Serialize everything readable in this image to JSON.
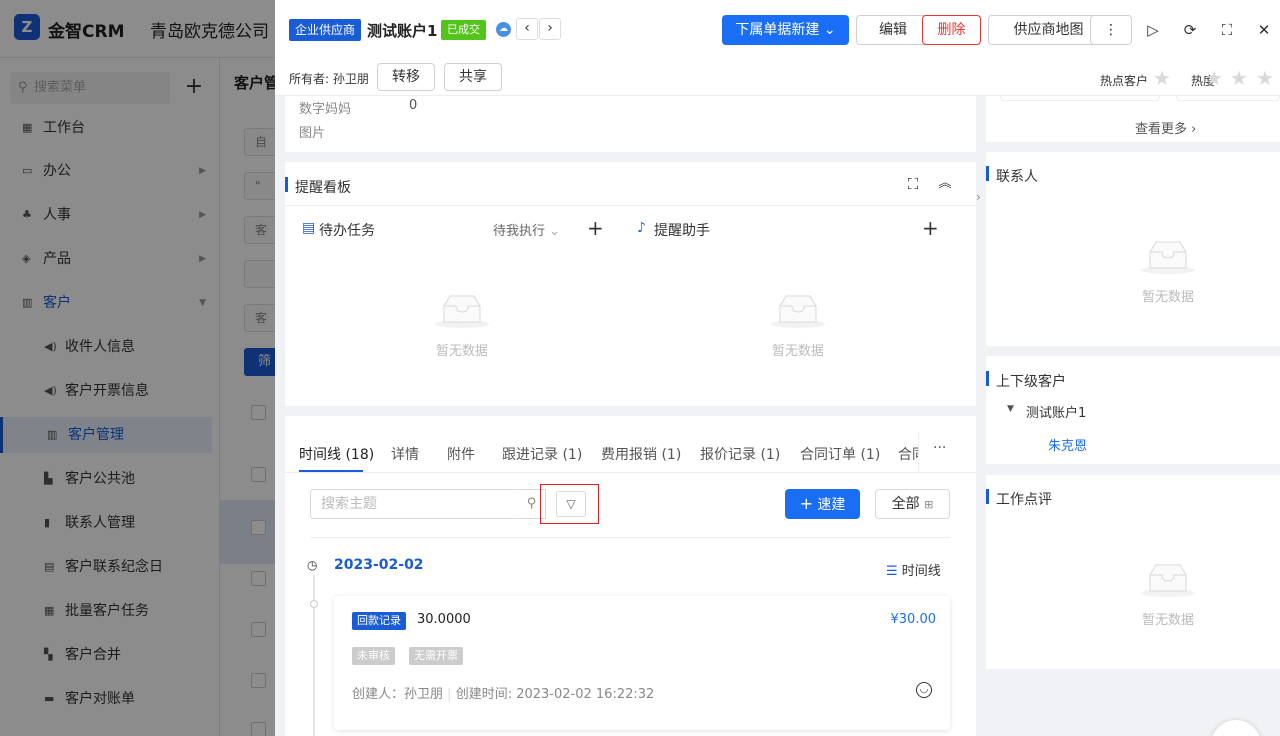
{
  "app": {
    "brand": "金智CRM",
    "company": "青岛欧克德公司",
    "logo_glyph": "Z",
    "accent": "#1a6ef5"
  },
  "sidebar": {
    "search_placeholder": "搜索菜单",
    "items": [
      {
        "label": "工作台",
        "icon": "dashboard-icon",
        "glyph": "▦"
      },
      {
        "label": "办公",
        "icon": "office-icon",
        "glyph": "▭",
        "has_arrow": true
      },
      {
        "label": "人事",
        "icon": "people-icon",
        "glyph": "♣",
        "has_arrow": true
      },
      {
        "label": "产品",
        "icon": "box-icon",
        "glyph": "◈",
        "has_arrow": true
      },
      {
        "label": "客户",
        "icon": "chart-icon",
        "glyph": "▥",
        "expanded": true
      }
    ],
    "sub_items": [
      {
        "label": "收件人信息",
        "icon": "speaker-icon",
        "glyph": "◀)"
      },
      {
        "label": "客户开票信息",
        "icon": "speaker-icon",
        "glyph": "◀)"
      },
      {
        "label": "客户管理",
        "icon": "chart-icon",
        "glyph": "▥",
        "active": true
      },
      {
        "label": "客户公共池",
        "icon": "pool-icon",
        "glyph": "▙"
      },
      {
        "label": "联系人管理",
        "icon": "contact-icon",
        "glyph": "▮"
      },
      {
        "label": "客户联系纪念日",
        "icon": "calendar-icon",
        "glyph": "▤"
      },
      {
        "label": "批量客户任务",
        "icon": "task-icon",
        "glyph": "▦"
      },
      {
        "label": "客户合并",
        "icon": "merge-icon",
        "glyph": "▚"
      },
      {
        "label": "客户对账单",
        "icon": "ledger-icon",
        "glyph": "▬"
      }
    ]
  },
  "background_page": {
    "title": "客户管",
    "stub1": "自",
    "stub2": "\"",
    "stub3": "客",
    "stub5": "客",
    "filter_btn": "筛"
  },
  "drawer": {
    "type_tag": "企业供应商",
    "title": "测试账户1",
    "status_tag": "已成交",
    "status_color": "#52c41a",
    "buttons": {
      "new_doc": "下属单据新建",
      "edit": "编辑",
      "delete": "删除",
      "supplier_map": "供应商地图"
    },
    "owner_label": "所有者:",
    "owner_name": "孙卫朋",
    "transfer": "转移",
    "share": "共享",
    "hot_customer": "热点客户",
    "heat": "热度",
    "heat_stars": 0
  },
  "info": {
    "digit_label": "数字妈妈",
    "digit_value": "0",
    "image_label": "图片"
  },
  "reminder": {
    "title": "提醒看板",
    "todo_title": "待办任务",
    "todo_filter": "待我执行",
    "assistant_title": "提醒助手",
    "empty": "暂无数据"
  },
  "tabs": [
    {
      "label": "时间线 (18)",
      "active": true
    },
    {
      "label": "详情"
    },
    {
      "label": "附件"
    },
    {
      "label": "跟进记录 (1)"
    },
    {
      "label": "费用报销 (1)"
    },
    {
      "label": "报价记录 (1)"
    },
    {
      "label": "合同订单 (1)"
    },
    {
      "label": "合同"
    }
  ],
  "timeline": {
    "search_placeholder": "搜索主题",
    "quick_new": "速建",
    "all": "全部",
    "view_label": "时间线",
    "date": "2023-02-02",
    "record": {
      "type_tag": "回款记录",
      "title": "30.0000",
      "amount": "¥30.00",
      "tag1": "未审核",
      "tag2": "无需开票",
      "creator_label": "创建人：",
      "creator": "孙卫朋",
      "created_label": "创建时间:",
      "created": "2023-02-02 16:22:32"
    }
  },
  "right": {
    "see_more": "查看更多",
    "contacts_title": "联系人",
    "hierarchy_title": "上下级客户",
    "hierarchy_node": "测试账户1",
    "hierarchy_child": "朱克恩",
    "review_title": "工作点评",
    "empty": "暂无数据"
  }
}
